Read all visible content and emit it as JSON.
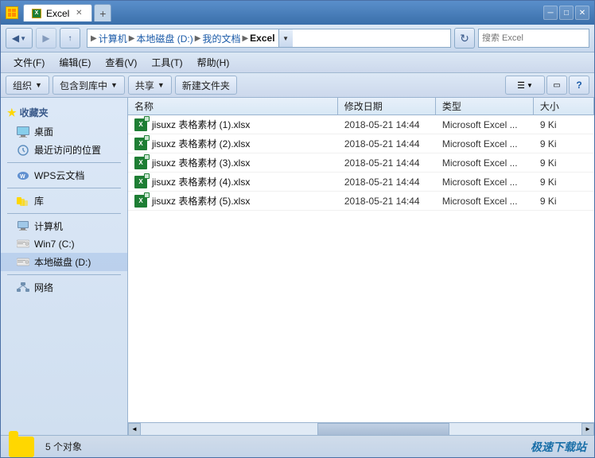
{
  "window": {
    "title": "Excel",
    "tabs": [
      {
        "label": "Excel",
        "active": true
      }
    ]
  },
  "address_bar": {
    "path_parts": [
      "计算机",
      "本地磁盘 (D:)",
      "我的文档",
      "Excel"
    ],
    "search_placeholder": "搜索 Excel"
  },
  "menu": {
    "items": [
      "文件(F)",
      "编辑(E)",
      "查看(V)",
      "工具(T)",
      "帮助(H)"
    ]
  },
  "toolbar": {
    "organize": "组织",
    "include_library": "包含到库中",
    "share": "共享",
    "new_folder": "新建文件夹",
    "dropdown_arrow": "▼"
  },
  "sidebar": {
    "favorites_label": "收藏夹",
    "desktop_label": "桌面",
    "recent_label": "最近访问的位置",
    "wps_label": "WPS云文档",
    "library_label": "库",
    "computer_label": "计算机",
    "win7_label": "Win7 (C:)",
    "local_disk_label": "本地磁盘 (D:)",
    "network_label": "网络"
  },
  "file_list": {
    "columns": [
      "名称",
      "修改日期",
      "类型",
      "大小"
    ],
    "files": [
      {
        "name": "jisuxz 表格素材 (1).xlsx",
        "date": "2018-05-21 14:44",
        "type": "Microsoft Excel ...",
        "size": "9 Ki"
      },
      {
        "name": "jisuxz 表格素材 (2).xlsx",
        "date": "2018-05-21 14:44",
        "type": "Microsoft Excel ...",
        "size": "9 Ki"
      },
      {
        "name": "jisuxz 表格素材 (3).xlsx",
        "date": "2018-05-21 14:44",
        "type": "Microsoft Excel ...",
        "size": "9 Ki"
      },
      {
        "name": "jisuxz 表格素材 (4).xlsx",
        "date": "2018-05-21 14:44",
        "type": "Microsoft Excel ...",
        "size": "9 Ki"
      },
      {
        "name": "jisuxz 表格素材 (5).xlsx",
        "date": "2018-05-21 14:44",
        "type": "Microsoft Excel ...",
        "size": "9 Ki"
      }
    ]
  },
  "status_bar": {
    "text": "5 个对象",
    "watermark": "极速下载站"
  },
  "icons": {
    "back": "◀",
    "forward": "▶",
    "up": "↑",
    "dropdown": "▼",
    "refresh": "↻",
    "search": "🔍",
    "close": "✕",
    "minimize": "─",
    "maximize": "□",
    "new_tab": "+",
    "prev": "◄",
    "next": "►",
    "star": "★"
  }
}
